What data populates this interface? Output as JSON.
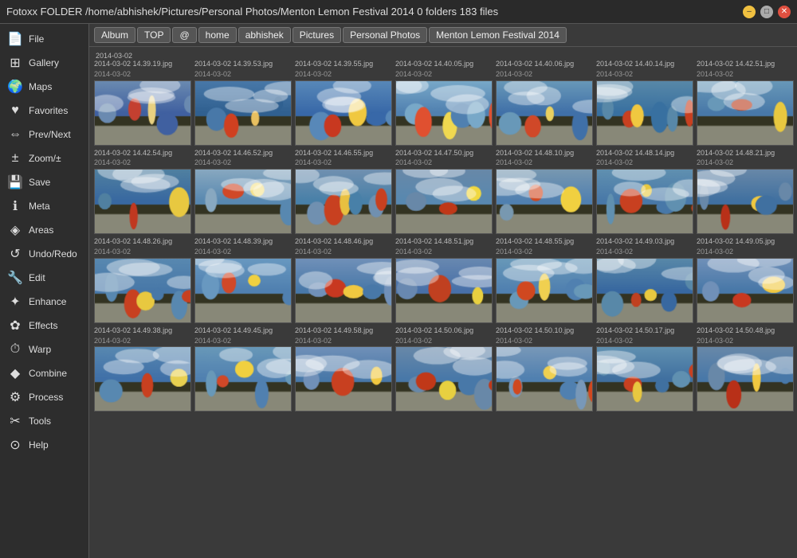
{
  "titlebar": {
    "title": "Fotoxx   FOLDER /home/abhishek/Pictures/Personal Photos/Menton Lemon Festival 2014   0 folders   183 files",
    "btn_min": "–",
    "btn_max": "□",
    "btn_close": "✕"
  },
  "breadcrumb": {
    "tabs": [
      "Album",
      "TOP",
      "@",
      "home",
      "abhishek",
      "Pictures",
      "Personal Photos",
      "Menton Lemon Festival 2014"
    ]
  },
  "sidebar": {
    "items": [
      {
        "label": "File",
        "icon": "📄"
      },
      {
        "label": "Gallery",
        "icon": "🔲"
      },
      {
        "label": "Maps",
        "icon": "🌍"
      },
      {
        "label": "Favorites",
        "icon": "❤️"
      },
      {
        "label": "Prev/Next",
        "icon": "↔"
      },
      {
        "label": "Zoom/±",
        "icon": "🔴"
      },
      {
        "label": "Save",
        "icon": "💊"
      },
      {
        "label": "Meta",
        "icon": "ℹ"
      },
      {
        "label": "Areas",
        "icon": "💧"
      },
      {
        "label": "Undo/Redo",
        "icon": "♻"
      },
      {
        "label": "Edit",
        "icon": "🔧"
      },
      {
        "label": "Enhance",
        "icon": "✨"
      },
      {
        "label": "Effects",
        "icon": "🎨"
      },
      {
        "label": "Warp",
        "icon": "⏰"
      },
      {
        "label": "Combine",
        "icon": "💎"
      },
      {
        "label": "Process",
        "icon": "⚙"
      },
      {
        "label": "Tools",
        "icon": "🔨"
      },
      {
        "label": "Help",
        "icon": "🛟"
      }
    ]
  },
  "gallery": {
    "row1": {
      "date": "2014-03-02",
      "photos": [
        {
          "file": "2014-03-02 14.39.19.jpg",
          "date": "2014-03-02",
          "colors": [
            "#6a8ab0",
            "#c44030",
            "#e8d080",
            "#4060a0"
          ]
        },
        {
          "file": "2014-03-02 14.39.53.jpg",
          "date": "2014-03-02",
          "colors": [
            "#4878a8",
            "#d04020",
            "#e8c060",
            "#306090"
          ]
        },
        {
          "file": "2014-03-02 14.39.55.jpg",
          "date": "2014-03-02",
          "colors": [
            "#5888b8",
            "#c83820",
            "#f0c840",
            "#3868a8"
          ]
        },
        {
          "file": "2014-03-02 14.40.05.jpg",
          "date": "2014-03-02",
          "colors": [
            "#78a8c8",
            "#e05030",
            "#f0d850",
            "#5080b0"
          ]
        },
        {
          "file": "2014-03-02 14.40.06.jpg",
          "date": "2014-03-02",
          "colors": [
            "#6898b8",
            "#d04828",
            "#e8d060",
            "#4070a8"
          ]
        },
        {
          "file": "2014-03-02 14.40.14.jpg",
          "date": "2014-03-02",
          "colors": [
            "#5888a8",
            "#c84020",
            "#f0c840",
            "#3870a0"
          ]
        },
        {
          "file": "2014-03-02 14.42.51.jpg",
          "date": "2014-03-02",
          "colors": [
            "#6898b8",
            "#b83818",
            "#e8c840",
            "#4878a8"
          ]
        }
      ]
    },
    "row2": {
      "photos": [
        {
          "file": "2014-03-02 14.42.54.jpg",
          "date": "2014-03-02",
          "colors": [
            "#5080a0",
            "#c03820",
            "#e8c840",
            "#3868a0"
          ]
        },
        {
          "file": "2014-03-02 14.46.52.jpg",
          "date": "2014-03-02",
          "colors": [
            "#88a8c0",
            "#d04828",
            "#f0d040",
            "#5888b0"
          ]
        },
        {
          "file": "2014-03-02 14.46.55.jpg",
          "date": "2014-03-02",
          "colors": [
            "#7090b0",
            "#c84020",
            "#e8c040",
            "#4880a8"
          ]
        },
        {
          "file": "2014-03-02 14.47.50.jpg",
          "date": "2014-03-02",
          "colors": [
            "#6888a8",
            "#c03818",
            "#f0d840",
            "#5888b0"
          ]
        },
        {
          "file": "2014-03-02 14.48.10.jpg",
          "date": "2014-03-02",
          "colors": [
            "#7898b0",
            "#d04820",
            "#f0d040",
            "#5080b0"
          ]
        },
        {
          "file": "2014-03-02 14.48.14.jpg",
          "date": "2014-03-02",
          "colors": [
            "#6090b0",
            "#c84020",
            "#e8c840",
            "#4878a8"
          ]
        },
        {
          "file": "2014-03-02 14.48.21.jpg",
          "date": "2014-03-02",
          "colors": [
            "#6888a8",
            "#b83018",
            "#f0c840",
            "#4070a0"
          ]
        }
      ]
    },
    "row3": {
      "photos": [
        {
          "file": "2014-03-02 14.48.26.jpg",
          "date": "2014-03-02",
          "colors": [
            "#5888b0",
            "#c84020",
            "#e8c840",
            "#4878a8"
          ]
        },
        {
          "file": "2014-03-02 14.48.39.jpg",
          "date": "2014-03-02",
          "colors": [
            "#6898c0",
            "#d04828",
            "#f0d040",
            "#5080b0"
          ]
        },
        {
          "file": "2014-03-02 14.48.46.jpg",
          "date": "2014-03-02",
          "colors": [
            "#7090b8",
            "#c83820",
            "#f0c840",
            "#4878a8"
          ]
        },
        {
          "file": "2014-03-02 14.48.51.jpg",
          "date": "2014-03-02",
          "colors": [
            "#6888b0",
            "#c04020",
            "#e8d040",
            "#4870a8"
          ]
        },
        {
          "file": "2014-03-02 14.48.55.jpg",
          "date": "2014-03-02",
          "colors": [
            "#6898b8",
            "#d04820",
            "#f0d050",
            "#5080b0"
          ]
        },
        {
          "file": "2014-03-02 14.49.03.jpg",
          "date": "2014-03-02",
          "colors": [
            "#5888a8",
            "#c04020",
            "#e8c840",
            "#3868a0"
          ]
        },
        {
          "file": "2014-03-02 14.49.05.jpg",
          "date": "2014-03-02",
          "colors": [
            "#7090b8",
            "#c83820",
            "#f0c840",
            "#4878a8"
          ]
        }
      ]
    },
    "row4": {
      "photos": [
        {
          "file": "2014-03-02 14.49.38.jpg",
          "date": "2014-03-02",
          "colors": [
            "#5888b0",
            "#c84020",
            "#e8d050",
            "#4070a8"
          ]
        },
        {
          "file": "2014-03-02 14.49.45.jpg",
          "date": "2014-03-02",
          "colors": [
            "#6898b8",
            "#d04828",
            "#f0d040",
            "#5080b0"
          ]
        },
        {
          "file": "2014-03-02 14.49.58.jpg",
          "date": "2014-03-02",
          "colors": [
            "#7090b8",
            "#c84020",
            "#f0c840",
            "#4878a8"
          ]
        },
        {
          "file": "2014-03-02 14.50.06.jpg",
          "date": "2014-03-02",
          "colors": [
            "#6888a8",
            "#c03818",
            "#e8d040",
            "#4878a8"
          ]
        },
        {
          "file": "2014-03-02 14.50.10.jpg",
          "date": "2014-03-02",
          "colors": [
            "#7898b8",
            "#d04820",
            "#f0d050",
            "#5080b0"
          ]
        },
        {
          "file": "2014-03-02 14.50.17.jpg",
          "date": "2014-03-02",
          "colors": [
            "#6090b0",
            "#c84020",
            "#e8c840",
            "#4070a0"
          ]
        },
        {
          "file": "2014-03-02 14.50.48.jpg",
          "date": "2014-03-02",
          "colors": [
            "#6888a8",
            "#b83018",
            "#f0c840",
            "#4878a8"
          ]
        }
      ]
    }
  }
}
